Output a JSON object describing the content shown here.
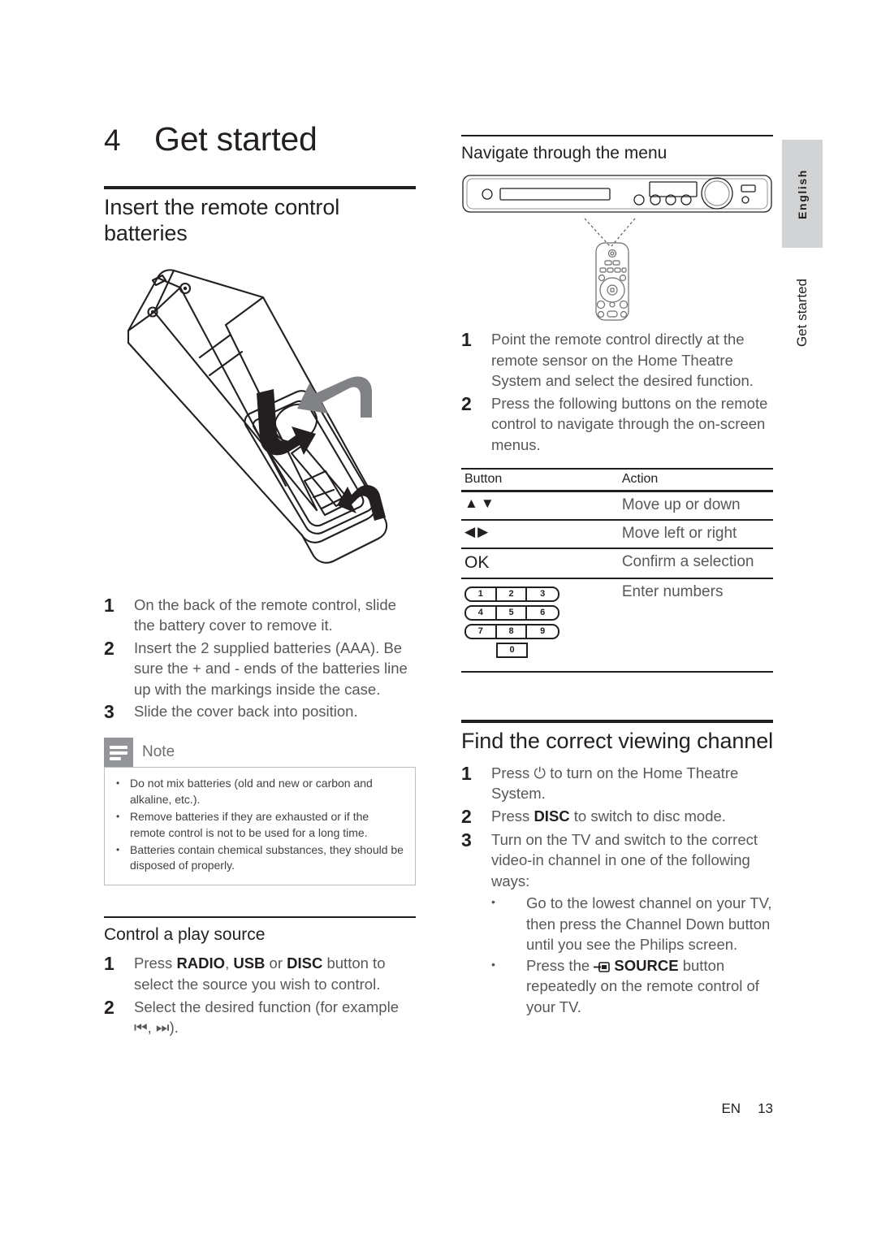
{
  "page": {
    "chapter_number": "4",
    "chapter_title": "Get started",
    "footer_lang": "EN",
    "footer_page": "13"
  },
  "sidebar": {
    "language_tab": "English",
    "section_tab": "Get started"
  },
  "left_column": {
    "heading": "Insert the remote control batteries",
    "illustration_name": "remote-control-battery-compartment-diagram",
    "steps": [
      {
        "num": "1",
        "text": "On the back of the remote control, slide the battery cover to remove it."
      },
      {
        "num": "2",
        "text": "Insert the 2 supplied batteries (AAA). Be sure the + and - ends of the batteries line up with the markings inside the case."
      },
      {
        "num": "3",
        "text": "Slide the cover back into position."
      }
    ],
    "note": {
      "title": "Note",
      "icon": "note-lines-icon",
      "items": [
        "Do not mix batteries (old and new or carbon and alkaline, etc.).",
        "Remove batteries if they are exhausted or if the remote control is not to be used for a long time.",
        "Batteries contain chemical substances, they should be disposed of properly."
      ]
    },
    "play_source": {
      "heading": "Control a play source",
      "steps": [
        {
          "num": "1",
          "parts": [
            {
              "t": "Press ",
              "b": false
            },
            {
              "t": "RADIO",
              "b": true
            },
            {
              "t": ", ",
              "b": false
            },
            {
              "t": "USB",
              "b": true
            },
            {
              "t": " or ",
              "b": false
            },
            {
              "t": "DISC",
              "b": true
            },
            {
              "t": " button to select the source you wish to control.",
              "b": false
            }
          ]
        },
        {
          "num": "2",
          "parts": [
            {
              "t": "Select the desired function (for example ",
              "b": false
            },
            {
              "t": "⏮, ⏭",
              "b": false
            },
            {
              "t": ").",
              "b": false
            }
          ]
        }
      ]
    }
  },
  "right_column": {
    "navigate": {
      "heading": "Navigate through the menu",
      "device_illustration": "home-theatre-front-panel-diagram",
      "remote_illustration": "remote-control-pointing-diagram",
      "steps": [
        {
          "num": "1",
          "text": "Point the remote control directly at the remote sensor on the Home Theatre System and select the desired function."
        },
        {
          "num": "2",
          "text": "Press the following buttons on the remote control to navigate through the on-screen menus."
        }
      ],
      "table": {
        "headers": [
          "Button",
          "Action"
        ],
        "rows": [
          {
            "button": "▲▼",
            "button_kind": "symbol",
            "action": "Move up or down"
          },
          {
            "button": "◀▶",
            "button_kind": "symbol",
            "action": "Move left or right"
          },
          {
            "button": "OK",
            "button_kind": "text",
            "action": "Confirm a selection"
          },
          {
            "button": "",
            "button_kind": "keypad",
            "action": "Enter numbers"
          }
        ],
        "keypad": {
          "rows": [
            [
              "1",
              "2",
              "3"
            ],
            [
              "4",
              "5",
              "6"
            ],
            [
              "7",
              "8",
              "9"
            ]
          ],
          "zero": "0"
        }
      }
    },
    "viewing_channel": {
      "heading": "Find the correct viewing channel",
      "steps": [
        {
          "num": "1",
          "parts": [
            {
              "t": "Press ",
              "b": false
            },
            {
              "t": "⏻",
              "b": false
            },
            {
              "t": " to turn on the Home Theatre System.",
              "b": false
            }
          ]
        },
        {
          "num": "2",
          "parts": [
            {
              "t": "Press ",
              "b": false
            },
            {
              "t": "DISC",
              "b": true
            },
            {
              "t": " to switch to disc mode.",
              "b": false
            }
          ]
        },
        {
          "num": "3",
          "parts": [
            {
              "t": "Turn on the TV and switch to the correct video-in channel in one of the following ways:",
              "b": false
            }
          ],
          "bullets": [
            {
              "parts": [
                {
                  "t": "Go to the lowest channel on your TV, then press the Channel Down button until you see the Philips screen.",
                  "b": false
                }
              ]
            },
            {
              "parts": [
                {
                  "t": "Press the ",
                  "b": false
                },
                {
                  "t": "__SOURCE_ICON__",
                  "b": false
                },
                {
                  "t": " SOURCE",
                  "b": true
                },
                {
                  "t": " button repeatedly on the remote control of your TV.",
                  "b": false
                }
              ]
            }
          ]
        }
      ]
    }
  }
}
